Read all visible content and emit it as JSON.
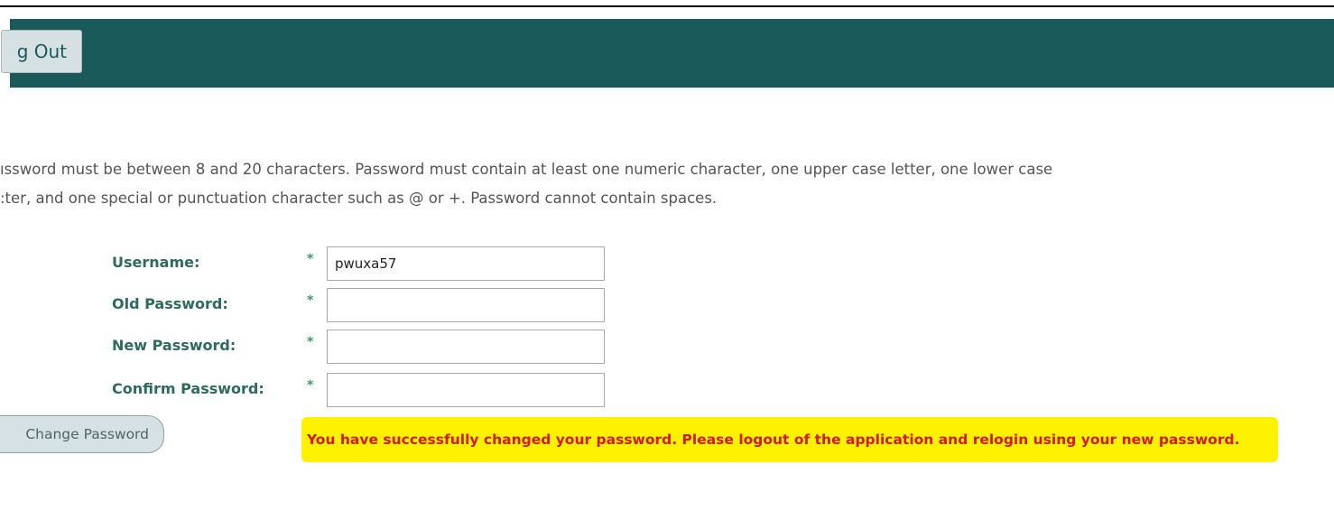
{
  "colors": {
    "header_bg": "#1b5a5a",
    "button_bg": "#d6e1e3",
    "label_color": "#2d6b5a",
    "required_color": "#3a9a6a",
    "success_text": "#d21a1a",
    "highlight": "#fff200",
    "change_button_text": "#4a6669"
  },
  "header": {
    "logout_label": "g Out"
  },
  "instructions": {
    "line1": "ıssword must be between 8 and 20 characters. Password must contain at least one numeric character, one upper case letter, one lower case",
    "line2": ":ter, and one special or punctuation character such as @ or +. Password cannot contain spaces."
  },
  "form": {
    "required_mark": "*",
    "fields": [
      {
        "label": "Username:",
        "value": "pwuxa57"
      },
      {
        "label": "Old Password:",
        "value": ""
      },
      {
        "label": "New Password:",
        "value": ""
      },
      {
        "label": "Confirm Password:",
        "value": ""
      }
    ],
    "submit_label": "Change Password"
  },
  "message": {
    "success": "You have successfully changed your password. Please logout of the application and relogin using your new password."
  }
}
